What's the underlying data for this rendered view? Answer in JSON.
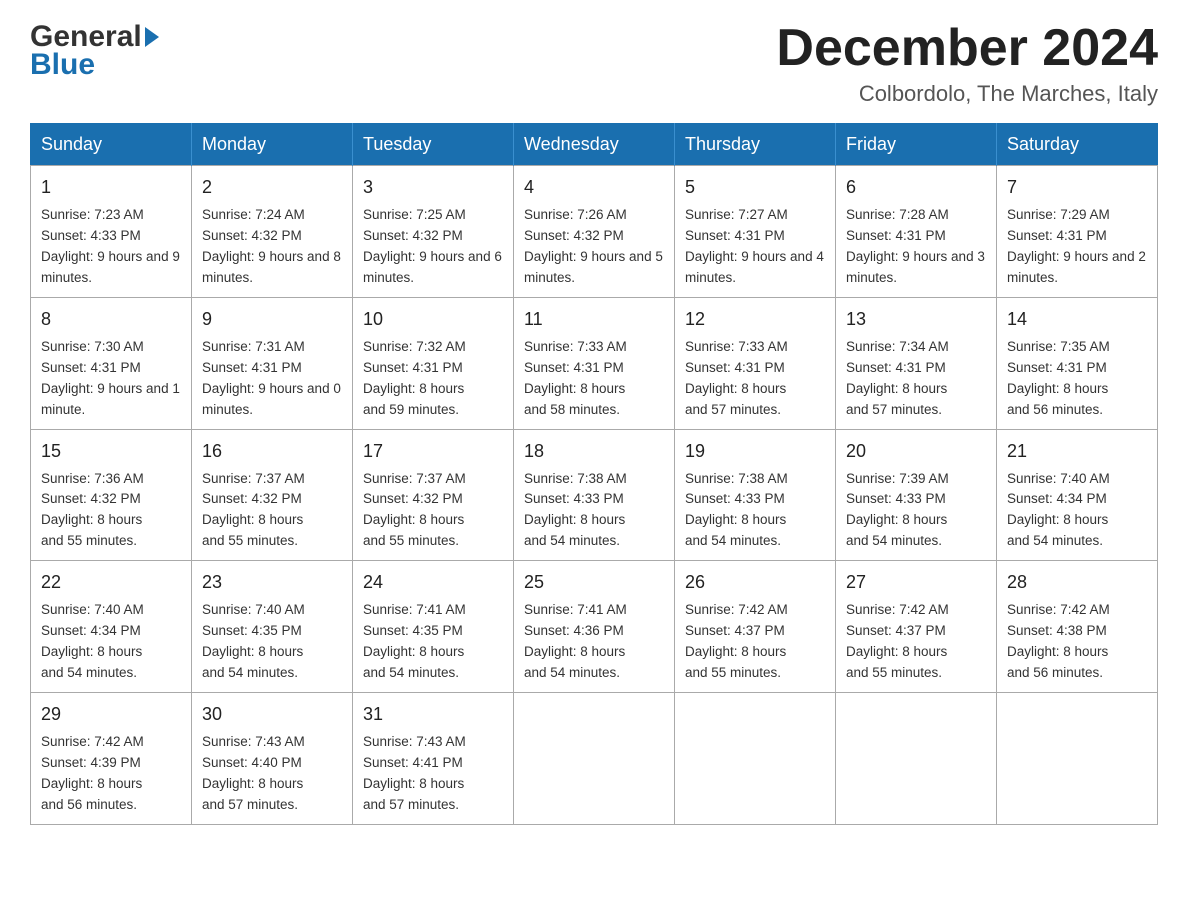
{
  "header": {
    "logo_line1": "General",
    "logo_line2": "Blue",
    "title": "December 2024",
    "subtitle": "Colbordolo, The Marches, Italy"
  },
  "days_of_week": [
    "Sunday",
    "Monday",
    "Tuesday",
    "Wednesday",
    "Thursday",
    "Friday",
    "Saturday"
  ],
  "weeks": [
    [
      {
        "day": "1",
        "sunrise": "7:23 AM",
        "sunset": "4:33 PM",
        "daylight": "9 hours and 9 minutes."
      },
      {
        "day": "2",
        "sunrise": "7:24 AM",
        "sunset": "4:32 PM",
        "daylight": "9 hours and 8 minutes."
      },
      {
        "day": "3",
        "sunrise": "7:25 AM",
        "sunset": "4:32 PM",
        "daylight": "9 hours and 6 minutes."
      },
      {
        "day": "4",
        "sunrise": "7:26 AM",
        "sunset": "4:32 PM",
        "daylight": "9 hours and 5 minutes."
      },
      {
        "day": "5",
        "sunrise": "7:27 AM",
        "sunset": "4:31 PM",
        "daylight": "9 hours and 4 minutes."
      },
      {
        "day": "6",
        "sunrise": "7:28 AM",
        "sunset": "4:31 PM",
        "daylight": "9 hours and 3 minutes."
      },
      {
        "day": "7",
        "sunrise": "7:29 AM",
        "sunset": "4:31 PM",
        "daylight": "9 hours and 2 minutes."
      }
    ],
    [
      {
        "day": "8",
        "sunrise": "7:30 AM",
        "sunset": "4:31 PM",
        "daylight": "9 hours and 1 minute."
      },
      {
        "day": "9",
        "sunrise": "7:31 AM",
        "sunset": "4:31 PM",
        "daylight": "9 hours and 0 minutes."
      },
      {
        "day": "10",
        "sunrise": "7:32 AM",
        "sunset": "4:31 PM",
        "daylight": "8 hours and 59 minutes."
      },
      {
        "day": "11",
        "sunrise": "7:33 AM",
        "sunset": "4:31 PM",
        "daylight": "8 hours and 58 minutes."
      },
      {
        "day": "12",
        "sunrise": "7:33 AM",
        "sunset": "4:31 PM",
        "daylight": "8 hours and 57 minutes."
      },
      {
        "day": "13",
        "sunrise": "7:34 AM",
        "sunset": "4:31 PM",
        "daylight": "8 hours and 57 minutes."
      },
      {
        "day": "14",
        "sunrise": "7:35 AM",
        "sunset": "4:31 PM",
        "daylight": "8 hours and 56 minutes."
      }
    ],
    [
      {
        "day": "15",
        "sunrise": "7:36 AM",
        "sunset": "4:32 PM",
        "daylight": "8 hours and 55 minutes."
      },
      {
        "day": "16",
        "sunrise": "7:37 AM",
        "sunset": "4:32 PM",
        "daylight": "8 hours and 55 minutes."
      },
      {
        "day": "17",
        "sunrise": "7:37 AM",
        "sunset": "4:32 PM",
        "daylight": "8 hours and 55 minutes."
      },
      {
        "day": "18",
        "sunrise": "7:38 AM",
        "sunset": "4:33 PM",
        "daylight": "8 hours and 54 minutes."
      },
      {
        "day": "19",
        "sunrise": "7:38 AM",
        "sunset": "4:33 PM",
        "daylight": "8 hours and 54 minutes."
      },
      {
        "day": "20",
        "sunrise": "7:39 AM",
        "sunset": "4:33 PM",
        "daylight": "8 hours and 54 minutes."
      },
      {
        "day": "21",
        "sunrise": "7:40 AM",
        "sunset": "4:34 PM",
        "daylight": "8 hours and 54 minutes."
      }
    ],
    [
      {
        "day": "22",
        "sunrise": "7:40 AM",
        "sunset": "4:34 PM",
        "daylight": "8 hours and 54 minutes."
      },
      {
        "day": "23",
        "sunrise": "7:40 AM",
        "sunset": "4:35 PM",
        "daylight": "8 hours and 54 minutes."
      },
      {
        "day": "24",
        "sunrise": "7:41 AM",
        "sunset": "4:35 PM",
        "daylight": "8 hours and 54 minutes."
      },
      {
        "day": "25",
        "sunrise": "7:41 AM",
        "sunset": "4:36 PM",
        "daylight": "8 hours and 54 minutes."
      },
      {
        "day": "26",
        "sunrise": "7:42 AM",
        "sunset": "4:37 PM",
        "daylight": "8 hours and 55 minutes."
      },
      {
        "day": "27",
        "sunrise": "7:42 AM",
        "sunset": "4:37 PM",
        "daylight": "8 hours and 55 minutes."
      },
      {
        "day": "28",
        "sunrise": "7:42 AM",
        "sunset": "4:38 PM",
        "daylight": "8 hours and 56 minutes."
      }
    ],
    [
      {
        "day": "29",
        "sunrise": "7:42 AM",
        "sunset": "4:39 PM",
        "daylight": "8 hours and 56 minutes."
      },
      {
        "day": "30",
        "sunrise": "7:43 AM",
        "sunset": "4:40 PM",
        "daylight": "8 hours and 57 minutes."
      },
      {
        "day": "31",
        "sunrise": "7:43 AM",
        "sunset": "4:41 PM",
        "daylight": "8 hours and 57 minutes."
      },
      null,
      null,
      null,
      null
    ]
  ],
  "labels": {
    "sunrise_prefix": "Sunrise: ",
    "sunset_prefix": "Sunset: ",
    "daylight_prefix": "Daylight: "
  }
}
